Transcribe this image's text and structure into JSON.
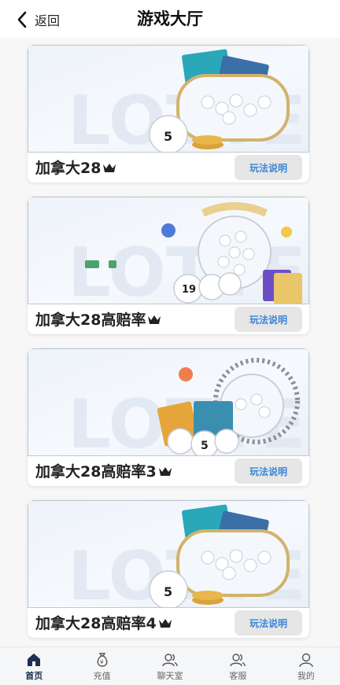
{
  "header": {
    "back_label": "返回",
    "title": "游戏大厅"
  },
  "games": [
    {
      "name": "加拿大28",
      "rules_label": "玩法说明",
      "banner_text": "LOTTERY",
      "ball_number": "5"
    },
    {
      "name": "加拿大28高赔率",
      "rules_label": "玩法说明",
      "banner_text": "LOTTERY",
      "ball_number": "19"
    },
    {
      "name": "加拿大28高赔率3",
      "rules_label": "玩法说明",
      "banner_text": "LOTTERY",
      "ball_number": "5"
    },
    {
      "name": "加拿大28高赔率4",
      "rules_label": "玩法说明",
      "banner_text": "LOTTERY",
      "ball_number": "5"
    }
  ],
  "tabbar": {
    "items": [
      {
        "label": "首页",
        "icon": "home-icon",
        "active": true
      },
      {
        "label": "充值",
        "icon": "money-bag-icon",
        "active": false
      },
      {
        "label": "聊天室",
        "icon": "chat-users-icon",
        "active": false
      },
      {
        "label": "客服",
        "icon": "customer-service-icon",
        "active": false
      },
      {
        "label": "我的",
        "icon": "user-icon",
        "active": false
      }
    ]
  },
  "colors": {
    "accent": "#3a86d8",
    "active_tab": "#1c2f4e",
    "button_bg": "#e6e6e6"
  }
}
